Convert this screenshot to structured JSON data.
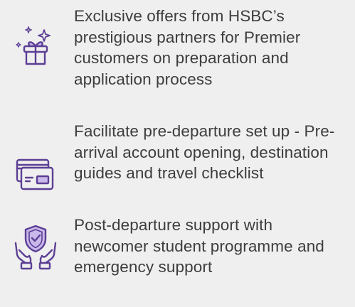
{
  "benefits": [
    {
      "icon": "gift-icon",
      "text": "Exclusive offers from HSBC’s prestigious partners for Premier customers on preparation and application process"
    },
    {
      "icon": "credit-card-icon",
      "text": "Facilitate pre-departure set up - Pre-arrival account opening, destination guides and travel checklist"
    },
    {
      "icon": "shield-hands-icon",
      "text": "Post-departure support with newcomer student programme and emergency support"
    }
  ],
  "colors": {
    "background": "#efefef",
    "text": "#3d3d3d",
    "icon_stroke": "#5c3f95",
    "icon_fill": "#c9b8ea"
  }
}
